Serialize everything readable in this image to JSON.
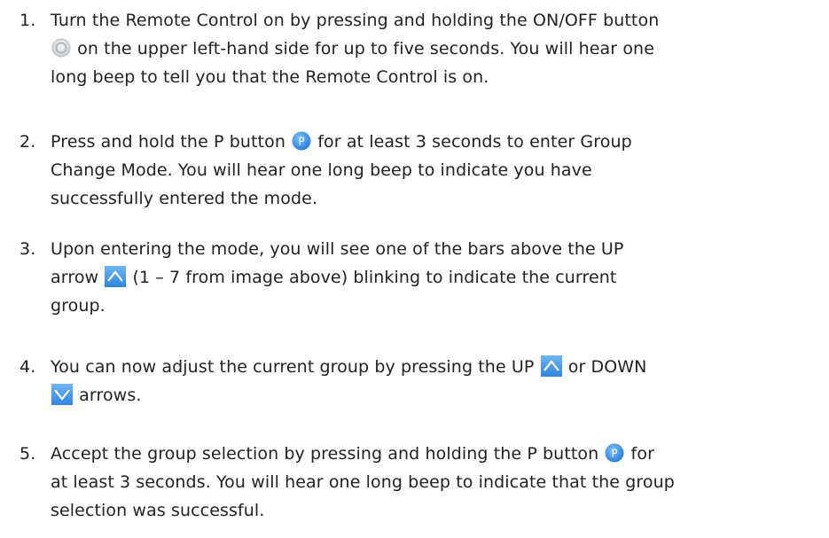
{
  "steps": [
    {
      "number": "1.",
      "lines": {
        "l1": "Turn the Remote Control on by pressing and holding the ON/OFF  button",
        "l2": " on the upper left-hand side for up to five seconds. You will hear one",
        "l3": "long beep to tell you that the Remote Control is on."
      }
    },
    {
      "number": "2.",
      "lines": {
        "l1a": "Press and hold the P button ",
        "l1b": " for at least 3 seconds to enter Group",
        "l2": "Change Mode.  You will hear one long beep to indicate you have",
        "l3": "successfully entered the mode."
      }
    },
    {
      "number": "3.",
      "lines": {
        "l1": "Upon entering the mode, you will see one of the bars above the UP",
        "l2a": "arrow ",
        "l2b": " (1 – 7 from image above) blinking to indicate the current",
        "l3": "group."
      }
    },
    {
      "number": "4.",
      "lines": {
        "l1a": "You can now adjust the current group by pressing the UP ",
        "l1b": " or DOWN",
        "l2": " arrows."
      }
    },
    {
      "number": "5.",
      "lines": {
        "l1a": "Accept the group selection by pressing and holding the P button ",
        "l1b": " for",
        "l2": "at least 3 seconds. You will hear one long beep to indicate that the group",
        "l3": "selection was successful."
      }
    }
  ],
  "icons": {
    "power": "power-button-icon",
    "p": "p-button-icon",
    "up": "up-arrow-icon",
    "down": "down-arrow-icon"
  },
  "colors": {
    "text": "#222222",
    "p_button": "#3d8ee6",
    "arrow_button": "#3a8fe0",
    "power_button": "#d8dcdf"
  }
}
